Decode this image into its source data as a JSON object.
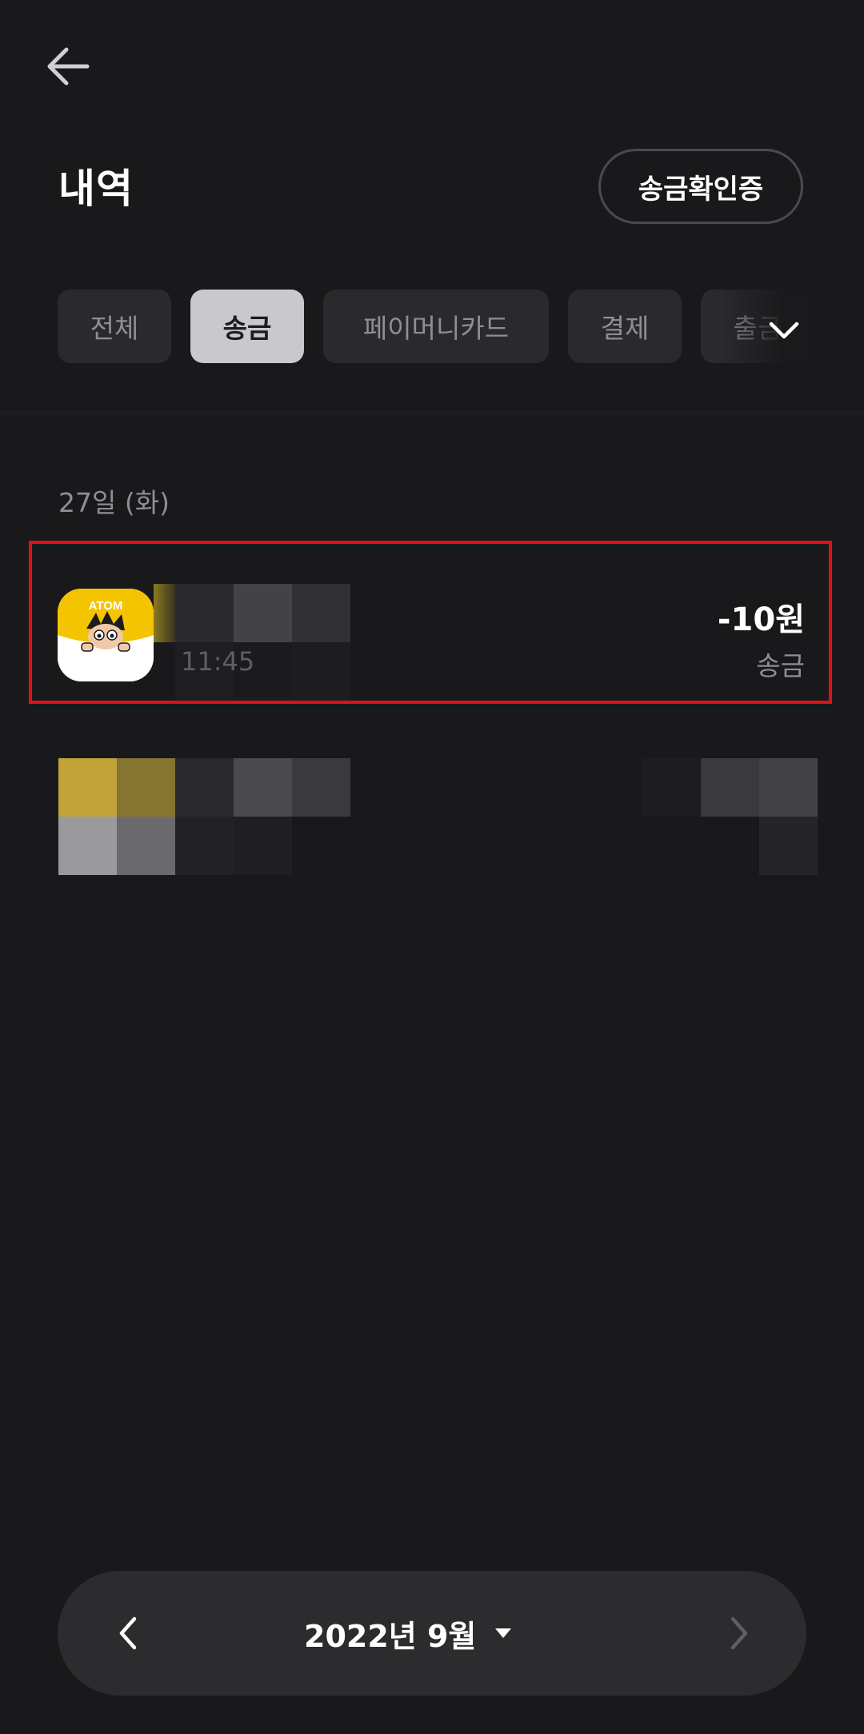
{
  "header": {
    "title": "내역",
    "confirm_button": "송금확인증"
  },
  "tabs": [
    {
      "label": "전체",
      "active": false
    },
    {
      "label": "송금",
      "active": true
    },
    {
      "label": "페이머니카드",
      "active": false
    },
    {
      "label": "결제",
      "active": false
    },
    {
      "label": "출금",
      "active": false
    }
  ],
  "list": {
    "date_header": "27일 (화)",
    "transactions": [
      {
        "avatar_text": "ATOM",
        "time": "11:45",
        "amount": "-10원",
        "type": "송금"
      }
    ]
  },
  "month_selector": {
    "label": "2022년 9월"
  },
  "icons": {
    "back": "arrow-left-icon",
    "tabs_more": "chevron-down-icon",
    "prev": "chevron-left-icon",
    "next": "chevron-right-icon",
    "month_dropdown": "caret-down-icon"
  },
  "colors": {
    "background": "#19191b",
    "active_tab": "#c8c8cd",
    "highlight_border": "#e01018",
    "avatar_yellow": "#f5c400"
  }
}
